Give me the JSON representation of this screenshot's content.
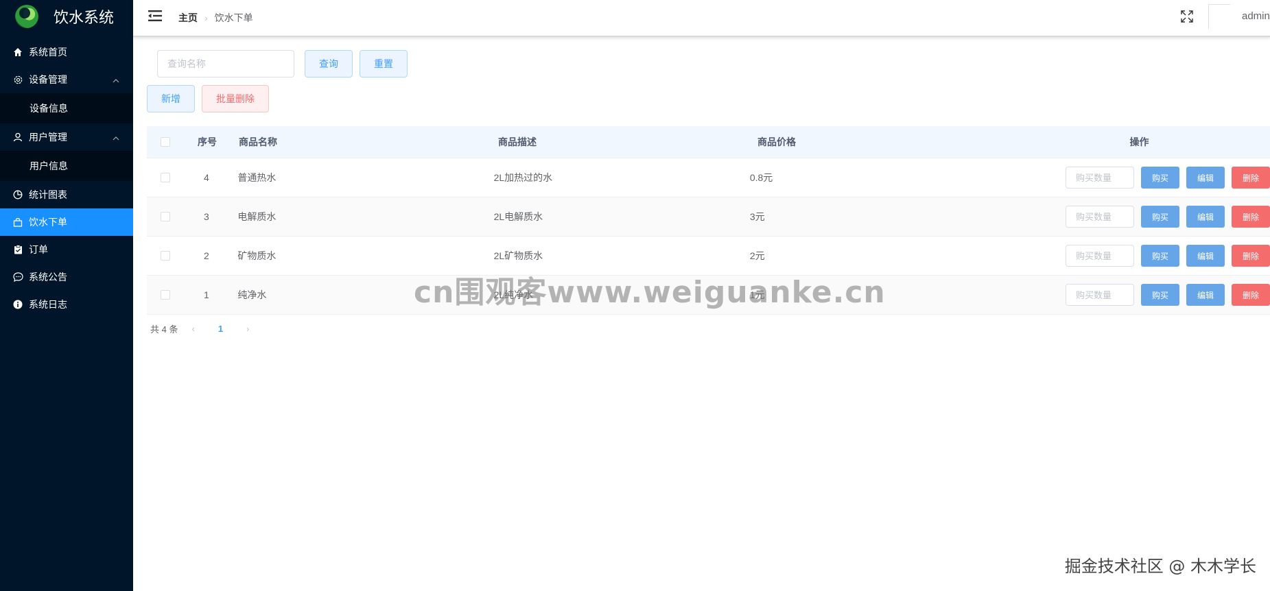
{
  "app": {
    "title": "饮水系统"
  },
  "sidebar": {
    "items": [
      {
        "label": "系统首页"
      },
      {
        "label": "设备管理"
      },
      {
        "label": "设备信息"
      },
      {
        "label": "用户管理"
      },
      {
        "label": "用户信息"
      },
      {
        "label": "统计图表"
      },
      {
        "label": "饮水下单"
      },
      {
        "label": "订单"
      },
      {
        "label": "系统公告"
      },
      {
        "label": "系统日志"
      }
    ]
  },
  "header": {
    "breadcrumb_home": "主页",
    "breadcrumb_current": "饮水下单",
    "user": "admin"
  },
  "toolbar": {
    "search_placeholder": "查询名称",
    "query_label": "查询",
    "reset_label": "重置",
    "add_label": "新增",
    "batch_delete_label": "批量删除"
  },
  "table": {
    "columns": [
      "序号",
      "商品名称",
      "商品描述",
      "商品价格",
      "操作"
    ],
    "rows": [
      {
        "idx": "4",
        "name": "普通热水",
        "desc": "2L加热过的水",
        "price": "0.8元"
      },
      {
        "idx": "3",
        "name": "电解质水",
        "desc": "2L电解质水",
        "price": "3元"
      },
      {
        "idx": "2",
        "name": "矿物质水",
        "desc": "2L矿物质水",
        "price": "2元"
      },
      {
        "idx": "1",
        "name": "纯净水",
        "desc": "2L纯净水",
        "price": "1元"
      }
    ],
    "qty_placeholder": "购买数量",
    "buy_label": "购买",
    "edit_label": "编辑",
    "delete_label": "删除"
  },
  "pagination": {
    "total": "共 4 条",
    "current_page": "1"
  },
  "watermark": "cn围观客www.weiguanke.cn",
  "footer_mark": "掘金技术社区 @ 木木学长",
  "colors": {
    "sidebar_bg": "#001529",
    "active": "#1890ff",
    "primary": "#409eff",
    "danger": "#f56c6c"
  }
}
